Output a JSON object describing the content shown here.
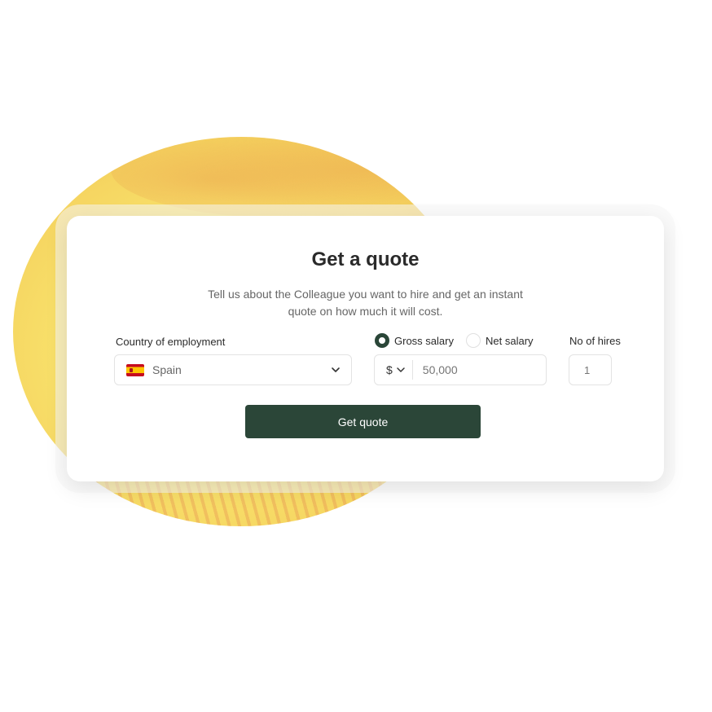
{
  "quote_form": {
    "title": "Get a quote",
    "subtitle": "Tell us about the Colleague you want to hire and get an instant quote on how much it will cost.",
    "country": {
      "label": "Country of employment",
      "value": "Spain",
      "flag_icon": "spain-flag-icon"
    },
    "salary": {
      "options": [
        {
          "label": "Gross salary",
          "selected": true
        },
        {
          "label": "Net salary",
          "selected": false
        }
      ],
      "currency": "$",
      "placeholder": "50,000"
    },
    "hires": {
      "label": "No of hires",
      "placeholder": "1"
    },
    "submit_label": "Get quote"
  },
  "colors": {
    "accent": "#2b4638",
    "blob": "#f8e06a"
  }
}
